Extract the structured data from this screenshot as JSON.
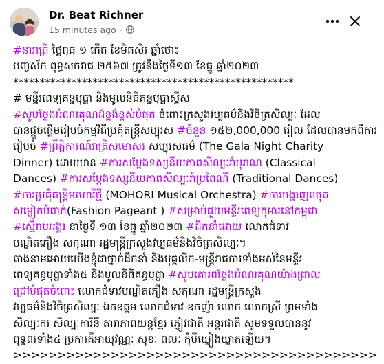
{
  "post": {
    "author": "Dr. Beat Richner",
    "timestamp": "15 minutes ago",
    "audience_icon": "globe-icon",
    "lines": [
      [
        {
          "t": "#នារាត្រី",
          "h": true
        },
        {
          "t": " ថ្ងៃពុធ ១ កើត ខែមិគសិរ ឆ្នាំថោះ",
          "h": false
        }
      ],
      [
        {
          "t": "បញ្ចស័ក ពុទ្ធសករាជ ២៥៦៧ ត្រូវនឹងថ្ងៃទី១៣ ខែធ្នូ ឆ្នាំ២០២៣",
          "h": false
        }
      ],
      [
        {
          "t": "*****************************************************",
          "h": false
        }
      ],
      [
        {
          "t": "# មន្ទីរពេទ្យគន្ធបុប្ផា និងមូលនិធិគន្ធបុប្ផាស្វីស",
          "h": false
        }
      ],
      [
        {
          "t": "#សូមថ្លែងអំណរគុណដ៏ខ្ពង់ខ្ពស់បំផុត",
          "h": true
        },
        {
          "t": " ចំពោះក្រសួងវប្បធម៌និងវិចិត្រសិល្បៈ ដែល",
          "h": false
        }
      ],
      [
        {
          "t": "បានផ្តួចផ្តើមរៀបចំកម្មវិធីប្រគុំតន្ត្រីសប្បុរស ",
          "h": false
        },
        {
          "t": "#ចំនួន",
          "h": true
        },
        {
          "t": " ១៥២,000,000 រៀល ដែលបានមកពីការ",
          "h": false
        }
      ],
      [
        {
          "t": "រៀបចំ ",
          "h": false
        },
        {
          "t": "#ព្រឹត្តិការណ៍រាត្រីសមោសរ",
          "h": true
        },
        {
          "t": " សប្បុរសធម៌ (The Gala Night Charity",
          "h": false
        }
      ],
      [
        {
          "t": "Dinner) ដោយមាន ",
          "h": false
        },
        {
          "t": "#ការសម្តែងទស្សនីយភាពសិល្បៈរាំបុរាណ",
          "h": true
        },
        {
          "t": " (Classical",
          "h": false
        }
      ],
      [
        {
          "t": "Dances) ",
          "h": false
        },
        {
          "t": "#ការសម្តែងទស្សនីយភាពសិល្បៈរាំប្រពៃណី",
          "h": true
        },
        {
          "t": " (Traditional Dances)",
          "h": false
        }
      ],
      [
        {
          "t": "#ការប្រគុំតន្ត្រីមហោរីថ្មី",
          "h": true
        },
        {
          "t": " (MOHORI Musical Orchestra) ",
          "h": false
        },
        {
          "t": "#ការបង្ហាញឈុត",
          "h": true
        }
      ],
      [
        {
          "t": "សម្លៀកបំពាក់",
          "h": true
        },
        {
          "t": "(Fashion Pageant ) ",
          "h": false
        },
        {
          "t": "#សម្រាប់ជួយមន្ទីរពេទ្យកុមារនៅកម្ពុជា",
          "h": true
        }
      ],
      [
        {
          "t": "#ស្មើរាបអង្គរ",
          "h": true
        },
        {
          "t": " នាថ្ងៃទី ១៣ ខែធ្នូ ឆ្នាំ២០២៣ ",
          "h": false
        },
        {
          "t": "#ដឹកនាំដោយ",
          "h": true
        },
        {
          "t": " លោកជំទាវ",
          "h": false
        }
      ],
      [
        {
          "t": "បណ្ឌិតភឿង សកុណា រដ្ឋមន្ត្រីក្រសួងវប្បធម៌និងវិចិត្រសិល្បៈ។",
          "h": false
        }
      ],
      [
        {
          "t": "តាងនាមអោយយើងខ្ញុំជាថ្នាក់ដឹកនាំ និងបុគ្គលិក-មន្ត្រីរាជការទាំងអស់នៃមន្ទីរ",
          "h": false
        }
      ],
      [
        {
          "t": "ពេទ្យគន្ធបុប្ផាទាំង៥ និងមូលនិធិគន្ធបុប្ផា ",
          "h": false
        },
        {
          "t": "#សូមគោរពថ្លែងអំណរគុណយ៉ាងជ្រាល",
          "h": true
        }
      ],
      [
        {
          "t": "ជ្រៅបំផុតចំពោះ",
          "h": true
        },
        {
          "t": " លោកជំទាវបណ្ឌិតភឿង សកុណា រដ្ឋមន្ត្រីក្រសួង",
          "h": false
        }
      ],
      [
        {
          "t": "វប្បធម៌និងវិចិត្រសិល្បៈ ឯកឧត្តម លោកជំទាវ ឧកញ៉ា លោក លោកស្រី ព្រមទាំង",
          "h": false
        }
      ],
      [
        {
          "t": "សិល្បៈករ សិល្បៈការិនី តារាភាពយន្តខ្មែរ ភ្ញៀវជាតិ អន្តរជាតិ សូមទទួលបាននូវ",
          "h": false
        }
      ],
      [
        {
          "t": "ពុទ្ធពរទាំង៤ ប្រការគឺអាយុវណ្ណៈ សុខៈ ពលៈ កុំបីឃ្លៀងឃ្លាតឡើយ។",
          "h": false
        }
      ],
      [
        {
          "t": ">>>>>>>>>>>>>>>>>>>>>>>>>>>>>>>>>>>>>>>>>>>>>>>>>>>>>>>",
          "h": false
        }
      ]
    ]
  },
  "colors": {
    "hashtag": "#b800f0",
    "text": "#050505",
    "meta": "#65676b"
  }
}
